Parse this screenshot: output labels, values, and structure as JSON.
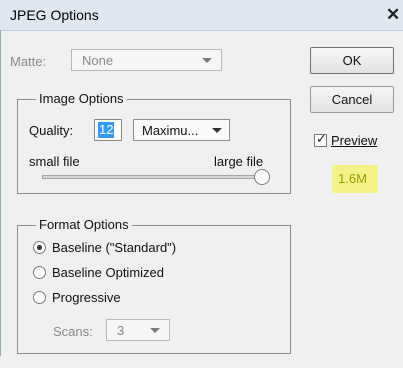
{
  "window": {
    "title": "JPEG Options",
    "close_glyph": "✕"
  },
  "matte": {
    "label": "Matte:",
    "value": "None"
  },
  "image_options": {
    "legend": "Image Options",
    "quality_label": "Quality:",
    "quality_value": "12",
    "quality_preset": "Maximu...",
    "small_file_label": "small file",
    "large_file_label": "large file",
    "slider_level": 1.0
  },
  "format_options": {
    "legend": "Format Options",
    "options": [
      {
        "label": "Baseline (\"Standard\")",
        "selected": true
      },
      {
        "label": "Baseline Optimized",
        "selected": false
      },
      {
        "label": "Progressive",
        "selected": false
      }
    ],
    "scans_label": "Scans:",
    "scans_value": "3"
  },
  "buttons": {
    "ok": "OK",
    "cancel": "Cancel"
  },
  "preview": {
    "label": "Preview",
    "checked": true,
    "file_size": "1.6M"
  },
  "colors": {
    "highlight": "#f3f38a",
    "selection": "#3399ff",
    "titlebar": "#dfe7f1"
  }
}
